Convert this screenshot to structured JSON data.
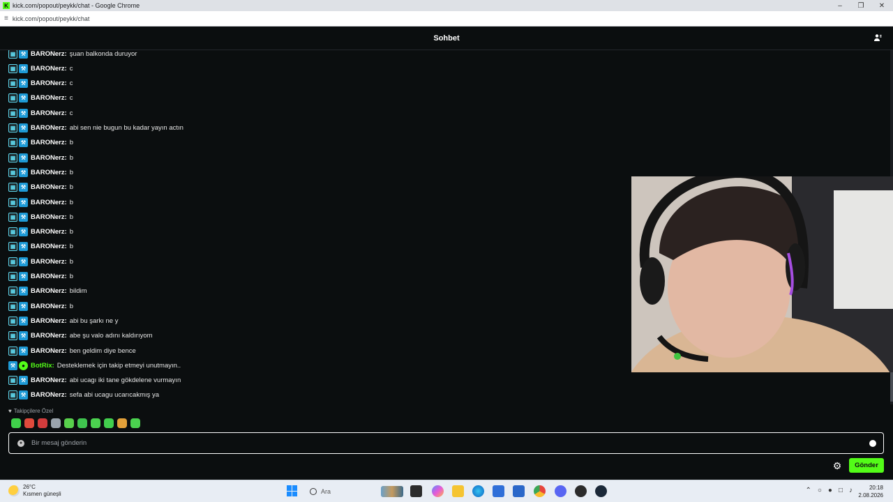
{
  "browser": {
    "window_title": "kick.com/popout/peykk/chat - Google Chrome",
    "url": "kick.com/popout/peykk/chat"
  },
  "chat": {
    "title": "Sohbet",
    "messages": [
      {
        "user": "BARONerz:",
        "text": "şuan balkonda duruyor",
        "type": "og-mod"
      },
      {
        "user": "BARONerz:",
        "text": "c",
        "type": "og-mod"
      },
      {
        "user": "BARONerz:",
        "text": "c",
        "type": "og-mod"
      },
      {
        "user": "BARONerz:",
        "text": "c",
        "type": "og-mod"
      },
      {
        "user": "BARONerz:",
        "text": "c",
        "type": "og-mod"
      },
      {
        "user": "BARONerz:",
        "text": "abi sen nie bugun bu kadar yayın actın",
        "type": "og-mod"
      },
      {
        "user": "BARONerz:",
        "text": "b",
        "type": "og-mod"
      },
      {
        "user": "BARONerz:",
        "text": "b",
        "type": "og-mod"
      },
      {
        "user": "BARONerz:",
        "text": "b",
        "type": "og-mod"
      },
      {
        "user": "BARONerz:",
        "text": "b",
        "type": "og-mod"
      },
      {
        "user": "BARONerz:",
        "text": "b",
        "type": "og-mod"
      },
      {
        "user": "BARONerz:",
        "text": "b",
        "type": "og-mod"
      },
      {
        "user": "BARONerz:",
        "text": "b",
        "type": "og-mod"
      },
      {
        "user": "BARONerz:",
        "text": "b",
        "type": "og-mod"
      },
      {
        "user": "BARONerz:",
        "text": "b",
        "type": "og-mod"
      },
      {
        "user": "BARONerz:",
        "text": "b",
        "type": "og-mod"
      },
      {
        "user": "BARONerz:",
        "text": "bildim",
        "type": "og-mod"
      },
      {
        "user": "BARONerz:",
        "text": "b",
        "type": "og-mod"
      },
      {
        "user": "BARONerz:",
        "text": "abi bu şarkı ne y",
        "type": "og-mod"
      },
      {
        "user": "BARONerz:",
        "text": "abe şu valo adını kaldırıyom",
        "type": "og-mod"
      },
      {
        "user": "BARONerz:",
        "text": "ben geldim diye bence",
        "type": "og-mod"
      },
      {
        "user": "BotRix:",
        "text": "Desteklemek için takip etmeyi unutmayın..",
        "type": "bot"
      },
      {
        "user": "BARONerz:",
        "text": "abi ucagı iki tane gökdelene vurmayın",
        "type": "og-mod"
      },
      {
        "user": "BARONerz:",
        "text": "sefa abi ucagu ucarıcakmış ya",
        "type": "og-mod"
      }
    ],
    "followers_only_label": "Takipçilere Özel",
    "emote_colors": [
      "#3fd14a",
      "#e04a3c",
      "#d23c3c",
      "#9aa4ad",
      "#58d04c",
      "#3fc44e",
      "#4bd24f",
      "#42cf4d",
      "#e3a13a",
      "#4bd24f"
    ],
    "input_placeholder": "Bir mesaj gönderin",
    "send_label": "Gönder"
  },
  "taskbar": {
    "weather_temp": "26°C",
    "weather_desc": "Kısmen güneşli",
    "search_placeholder": "Ara",
    "time": "20:18",
    "date": "2.08.2026"
  },
  "colors": {
    "accent": "#53fc18",
    "background": "#0b0e0f"
  }
}
